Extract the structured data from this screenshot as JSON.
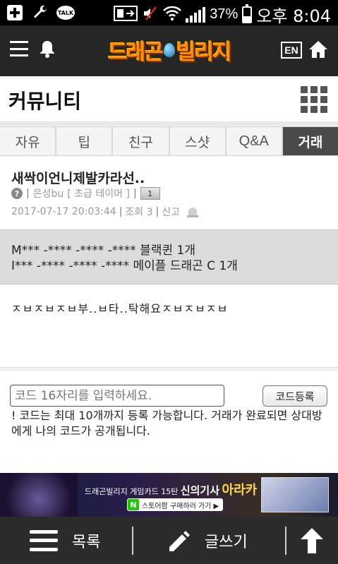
{
  "status_bar": {
    "talk_label": "TALK",
    "battery_percent": "37%",
    "battery_level": 0.37,
    "time": "오후 8:04"
  },
  "header": {
    "logo_part1": "드래곤",
    "logo_part2": "빌리지",
    "lang_label": "EN"
  },
  "section": {
    "title": "커뮤니티"
  },
  "tabs": [
    {
      "label": "자유",
      "active": false
    },
    {
      "label": "팁",
      "active": false
    },
    {
      "label": "친구",
      "active": false
    },
    {
      "label": "스샷",
      "active": false
    },
    {
      "label": "Q&A",
      "active": false
    },
    {
      "label": "거래",
      "active": true
    }
  ],
  "post": {
    "title": "새싹이언니제발카라선..",
    "author": "은성bu",
    "rank": "[ 초급 테이머 ]",
    "level": "1",
    "date": "2017-07-17 20:03:44",
    "views": "조회 3",
    "report_label": "신고",
    "codes": [
      "M*** -**** -**** -**** 블랙퀸 1개",
      "I*** -**** -**** -**** 메이플 드래곤 C 1개"
    ],
    "body": "ㅈㅂㅈㅂㅈㅂ부..ㅂ타..탁해요ㅈㅂㅈㅂㅈㅂ"
  },
  "registration": {
    "placeholder": "코드 16자리를 입력하세요.",
    "button_label": "코드등록",
    "note": "! 코드는 최대 10개까지 등록 가능합니다. 거래가 완료되면 상대방에게 나의 코드가 공개됩니다."
  },
  "ad": {
    "line1_a": "드래곤빌리지 게임카드",
    "line1_b": "15탄",
    "line1_c": "신의기사",
    "line1_d": "아라카",
    "store_icon": "N",
    "store_label": "스토어팜 구매하러 가기 ▶"
  },
  "bottom_bar": {
    "list_label": "목록",
    "write_label": "글쓰기"
  }
}
